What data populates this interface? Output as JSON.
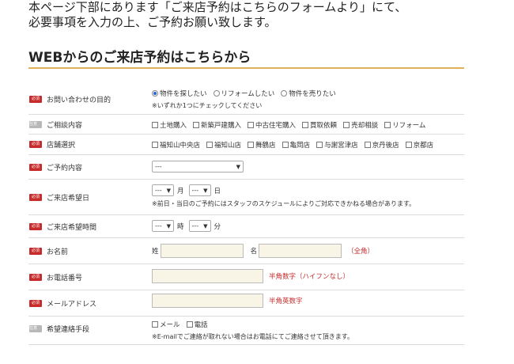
{
  "intro": {
    "line1": "本ページ下部にあります「ご来店予約はこちらのフォームより」にて、",
    "line2": "必要事項を入力の上、ご予約お願い致します。"
  },
  "form_title": "WEBからのご来店予約はこちらから",
  "badges": {
    "required": "必須",
    "optional": "任意"
  },
  "rows": {
    "inquiry": {
      "label": "お問い合わせの目的",
      "options": [
        "物件を探したい",
        "リフォームしたい",
        "物件を売りたい"
      ],
      "selected": "物件を探したい",
      "note": "※いずれか1つにチェックしてください"
    },
    "consult": {
      "label": "ご相談内容",
      "options": [
        "土地購入",
        "新築戸建購入",
        "中古住宅購入",
        "買取依頼",
        "売却相談",
        "リフォーム"
      ]
    },
    "store": {
      "label": "店舗選択",
      "options": [
        "福知山中央店",
        "福知山店",
        "舞鶴店",
        "亀岡店",
        "与謝宮津店",
        "京丹後店",
        "京都店"
      ]
    },
    "reservation": {
      "label": "ご予約内容",
      "value": "---"
    },
    "date": {
      "label": "ご来店希望日",
      "month_value": "---",
      "month_unit": "月",
      "day_value": "---",
      "day_unit": "日",
      "note": "※前日・当日のご予約にはスタッフのスケジュールによりご対応できかねる場合があります。"
    },
    "time": {
      "label": "ご来店希望時間",
      "hour_value": "---",
      "hour_unit": "時",
      "minute_value": "---",
      "minute_unit": "分"
    },
    "name": {
      "label": "お名前",
      "last_label": "姓",
      "first_label": "名",
      "hint": "（全角）"
    },
    "phone": {
      "label": "お電話番号",
      "hint": "半角数字（ハイフンなし）"
    },
    "email": {
      "label": "メールアドレス",
      "hint": "半角英数字"
    },
    "contact": {
      "label": "希望連絡手段",
      "options": [
        "メール",
        "電話"
      ],
      "note": "※E-mailでご連絡が取れない場合はお電話にてご連絡させて頂きます。"
    }
  }
}
